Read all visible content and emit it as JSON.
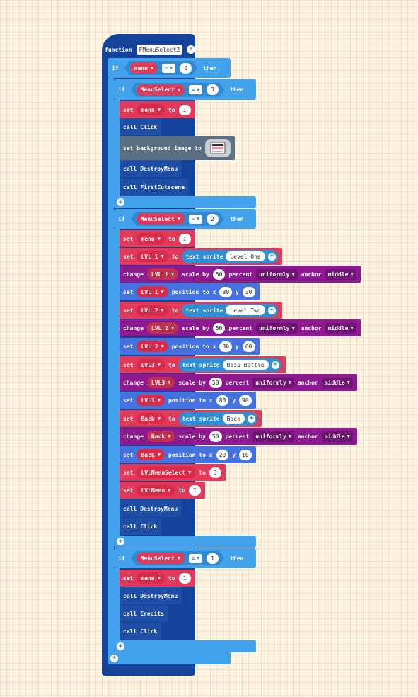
{
  "function": {
    "keyword": "function",
    "name": "FMenuSelect2"
  },
  "if_keyword": "if",
  "then_keyword": "then",
  "eq_op": "=",
  "if_blocks": [
    {
      "var": "menu",
      "value": "0"
    },
    {
      "var": "MenuSelect",
      "value": "3"
    },
    {
      "var": "MenuSelect",
      "value": "2"
    },
    {
      "var": "MenuSelect",
      "value": "1"
    }
  ],
  "keywords": {
    "set": "set",
    "to": "to",
    "call": "call",
    "change": "change",
    "text_sprite": "text sprite",
    "scale_by": "scale by",
    "percent": "percent",
    "anchor": "anchor",
    "position_to_x": "position to x",
    "y": "y",
    "set_background": "set background image to",
    "uniformly": "uniformly",
    "middle": "middle"
  },
  "branch3": {
    "set_menu": {
      "var": "menu",
      "value": "1"
    },
    "call_click": "Click",
    "call_destroy": "DestroyMenu",
    "call_cutscene": "FirstCutscene"
  },
  "branch2": {
    "set_menu": {
      "var": "menu",
      "value": "1"
    },
    "sprites": [
      {
        "var": "LVL 1",
        "text": "Level One",
        "scale": "50",
        "x": "80",
        "y": "30"
      },
      {
        "var": "LVL 2",
        "text": "Level Two",
        "scale": "50",
        "x": "80",
        "y": "60"
      },
      {
        "var": "LVL3",
        "text": "Boss Battle",
        "scale": "50",
        "x": "80",
        "y": "90"
      },
      {
        "var": "Back",
        "text": "Back",
        "scale": "50",
        "x": "20",
        "y": "10"
      }
    ],
    "set_lvlmenuselect": {
      "var": "LVLMenuSelect",
      "value": "3"
    },
    "set_lvlmenu": {
      "var": "LVLMenu",
      "value": "1"
    },
    "call_destroy": "DestroyMenu",
    "call_click": "Click"
  },
  "branch1": {
    "set_menu": {
      "var": "menu",
      "value": "1"
    },
    "call_destroy": "DestroyMenu",
    "call_credits": "Credits",
    "call_click": "Click"
  },
  "colors": {
    "function": "#13439a",
    "logic": "#42a3ec",
    "variables": "#e0395a",
    "sprites": "#4472e0",
    "effects": "#8e1a92",
    "scene": "#5b6f84"
  }
}
